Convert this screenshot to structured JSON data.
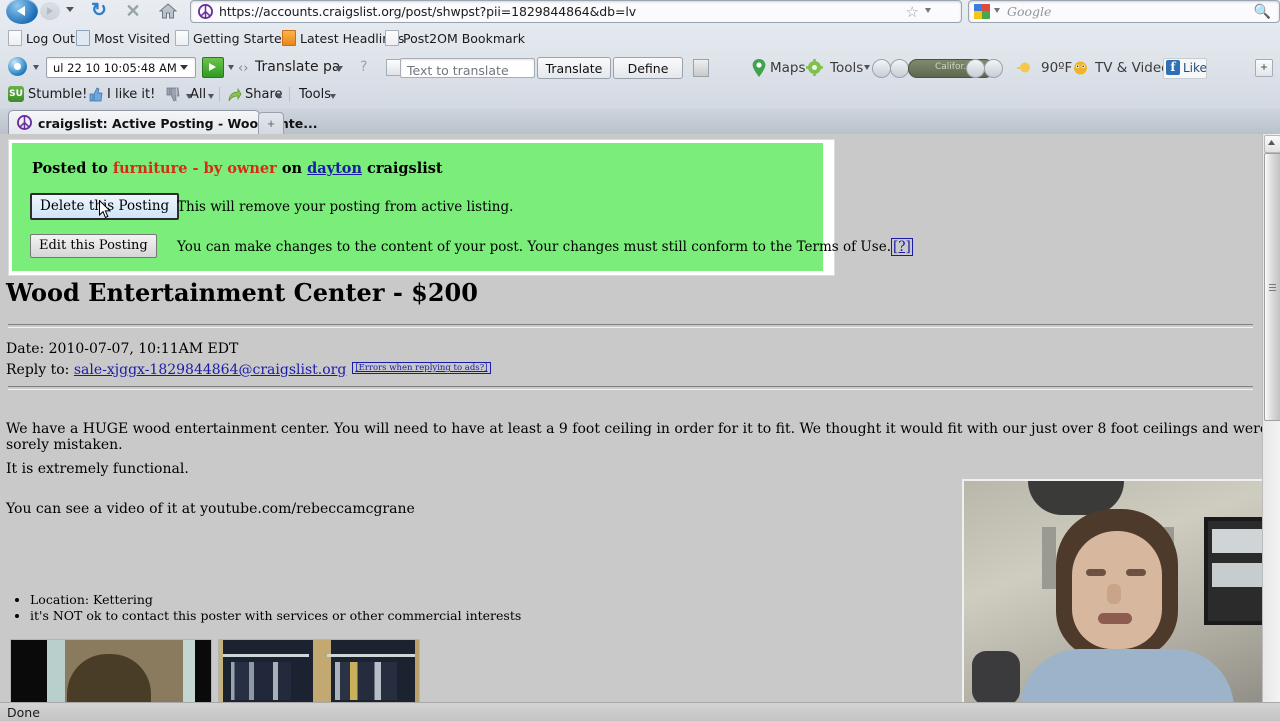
{
  "browser": {
    "url": "https://accounts.craigslist.org/post/shwpst?pii=1829844864&db=lv",
    "url_favicon_icon": "craigslist-peace-icon",
    "back_icon": "back-arrow-icon",
    "forward_icon": "forward-arrow-icon",
    "reload_icon": "reload-icon",
    "stop_icon": "stop-icon",
    "home_icon": "home-icon",
    "bookmark_star_icon": "star-icon",
    "search": {
      "engine_icon": "google-icon",
      "placeholder": "Google",
      "go_icon": "magnifier-icon"
    },
    "bookmarks": [
      {
        "label": "Log Out",
        "icon": "page-icon"
      },
      {
        "label": "Most Visited",
        "icon": "most-visited-icon"
      },
      {
        "label": "Getting Started",
        "icon": "page-icon"
      },
      {
        "label": "Latest Headlines",
        "icon": "rss-icon"
      },
      {
        "label": "Post2OM Bookmark",
        "icon": "page-icon"
      }
    ],
    "translate_toolbar": {
      "logo_icon": "translate-logo-icon",
      "history_value": "ul 22 10 10:05:48 AM",
      "go_icon": "green-go-arrow-icon",
      "language_value": "Translate pa",
      "help_icon": "question-icon",
      "note_icon": "notepad-icon",
      "input_placeholder": "Text to translate",
      "translate_label": "Translate",
      "define_label": "Define",
      "calculator_icon": "calculator-icon",
      "maps_label": "Maps",
      "maps_icon": "map-pin-icon",
      "tools_label": "Tools",
      "tools_icon": "gear-icon",
      "radio_station": "Califor...",
      "weather_label": "90ºF",
      "weather_icon": "sun-icon",
      "tv_label": "TV & Video",
      "tv_icon": "tv-icon",
      "like_label": "Like",
      "like_icon": "facebook-icon",
      "add_label": "+"
    },
    "stumble_toolbar": {
      "logo_icon": "stumbleupon-icon",
      "logo_text": "SU",
      "stumble_label": "Stumble!",
      "thumbup_icon": "thumbs-up-icon",
      "like_label": "I like it!",
      "thumbdown_icon": "thumbs-down-icon",
      "all_label": "All",
      "share_label": "Share",
      "share_icon": "share-icon",
      "tools_label": "Tools"
    },
    "tab": {
      "title": "craigslist: Active Posting - Wood Ente...",
      "favicon_icon": "craigslist-peace-icon",
      "new_tab_label": "+"
    },
    "status": "Done"
  },
  "page": {
    "notice": {
      "posted_prefix": "Posted to",
      "category": "furniture - by owner",
      "on_word": "on",
      "city": "dayton",
      "suffix": "craigslist",
      "delete_button": "Delete this Posting",
      "delete_desc": "This will remove your posting from active listing.",
      "edit_button": "Edit this Posting",
      "edit_desc": "You can make changes to the content of your post. Your changes must still conform to the Terms of Use.",
      "edit_help_link": "[?]",
      "bg_color": "#7bed7b"
    },
    "title": "Wood Entertainment Center - $200",
    "date_label": "Date: 2010-07-07, 10:11AM EDT",
    "reply_label": "Reply to:",
    "reply_email": "sale-xjggx-1829844864@craigslist.org",
    "errors_link": "[Errors when replying to ads?]",
    "paragraphs": [
      "We have a HUGE wood entertainment center. You will need to have at least a 9 foot ceiling in order for it to fit. We thought it would fit with our just over 8 foot ceilings and were sorely mistaken.",
      "It is extremely functional.",
      "You can see a video of it at youtube.com/rebeccamcgrane"
    ],
    "bullets": [
      "Location: Kettering",
      "it's NOT ok to contact this poster with services or other commercial interests"
    ],
    "images": [
      {
        "name": "entertainment-center-photo-1"
      },
      {
        "name": "entertainment-center-photo-2"
      }
    ],
    "webcam_overlay": {
      "name": "webcam-video-overlay"
    },
    "scrollbar": {
      "up_arrow_icon": "scroll-up-arrow-icon",
      "grip_icon": "scrollbar-grip-icon"
    }
  }
}
